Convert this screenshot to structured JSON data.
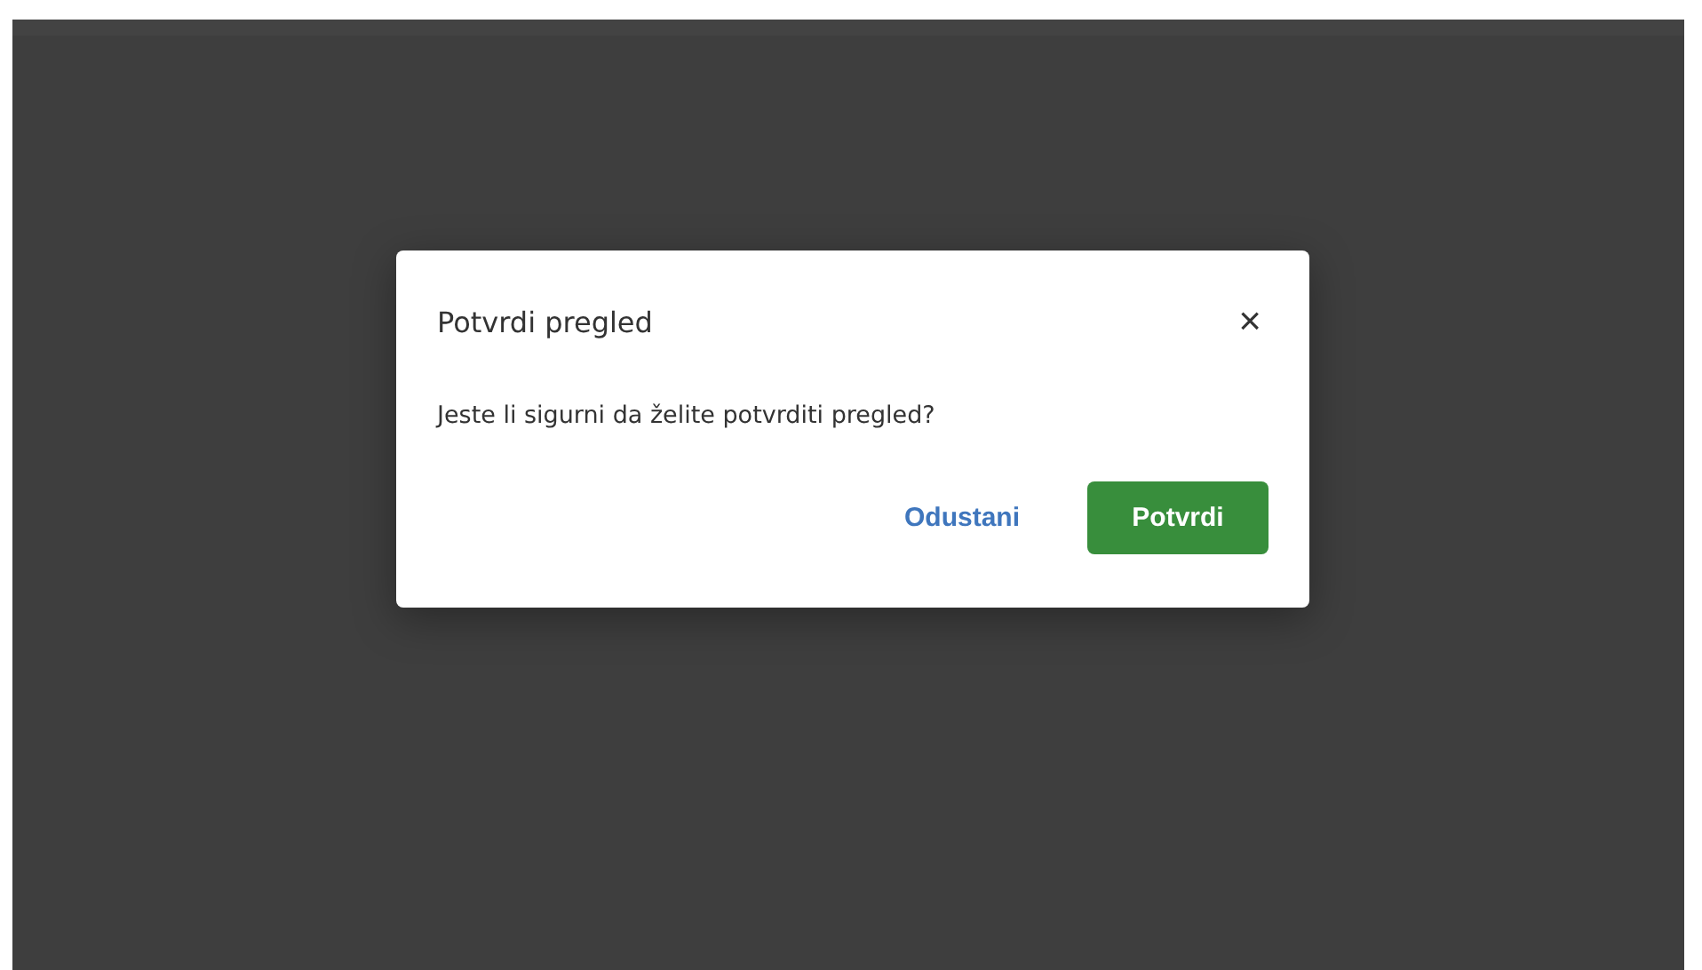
{
  "dialog": {
    "title": "Potvrdi pregled",
    "close": "×",
    "message": "Jeste li sigurni da želite potvrditi pregled?",
    "buttons": [
      {
        "label": "Odustani",
        "kind": "text"
      },
      {
        "label": "Potvrdi",
        "kind": "primary"
      }
    ]
  }
}
